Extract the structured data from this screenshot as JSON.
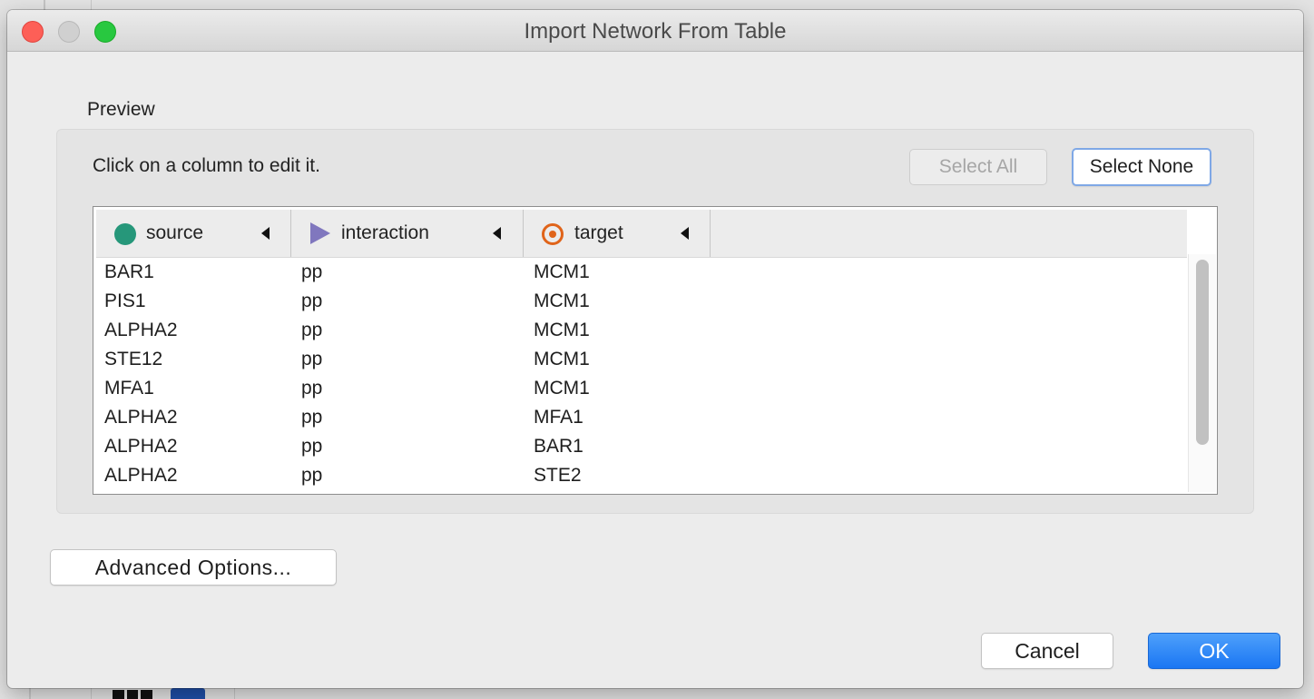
{
  "window": {
    "title": "Import Network From Table"
  },
  "preview": {
    "label": "Preview",
    "instruction": "Click on a column to edit it.",
    "select_all_label": "Select All",
    "select_none_label": "Select None"
  },
  "table": {
    "columns": [
      {
        "label": "source",
        "icon": "source-node-icon",
        "color": "#26977a"
      },
      {
        "label": "interaction",
        "icon": "interaction-icon",
        "color": "#8077be"
      },
      {
        "label": "target",
        "icon": "target-node-icon",
        "color": "#e0641a"
      }
    ],
    "rows": [
      {
        "source": "BAR1",
        "interaction": "pp",
        "target": "MCM1"
      },
      {
        "source": "PIS1",
        "interaction": "pp",
        "target": "MCM1"
      },
      {
        "source": "ALPHA2",
        "interaction": "pp",
        "target": "MCM1"
      },
      {
        "source": "STE12",
        "interaction": "pp",
        "target": "MCM1"
      },
      {
        "source": "MFA1",
        "interaction": "pp",
        "target": "MCM1"
      },
      {
        "source": "ALPHA2",
        "interaction": "pp",
        "target": "MFA1"
      },
      {
        "source": "ALPHA2",
        "interaction": "pp",
        "target": "BAR1"
      },
      {
        "source": "ALPHA2",
        "interaction": "pp",
        "target": "STE2"
      }
    ]
  },
  "footer": {
    "advanced_label": "Advanced Options...",
    "cancel_label": "Cancel",
    "ok_label": "OK"
  }
}
